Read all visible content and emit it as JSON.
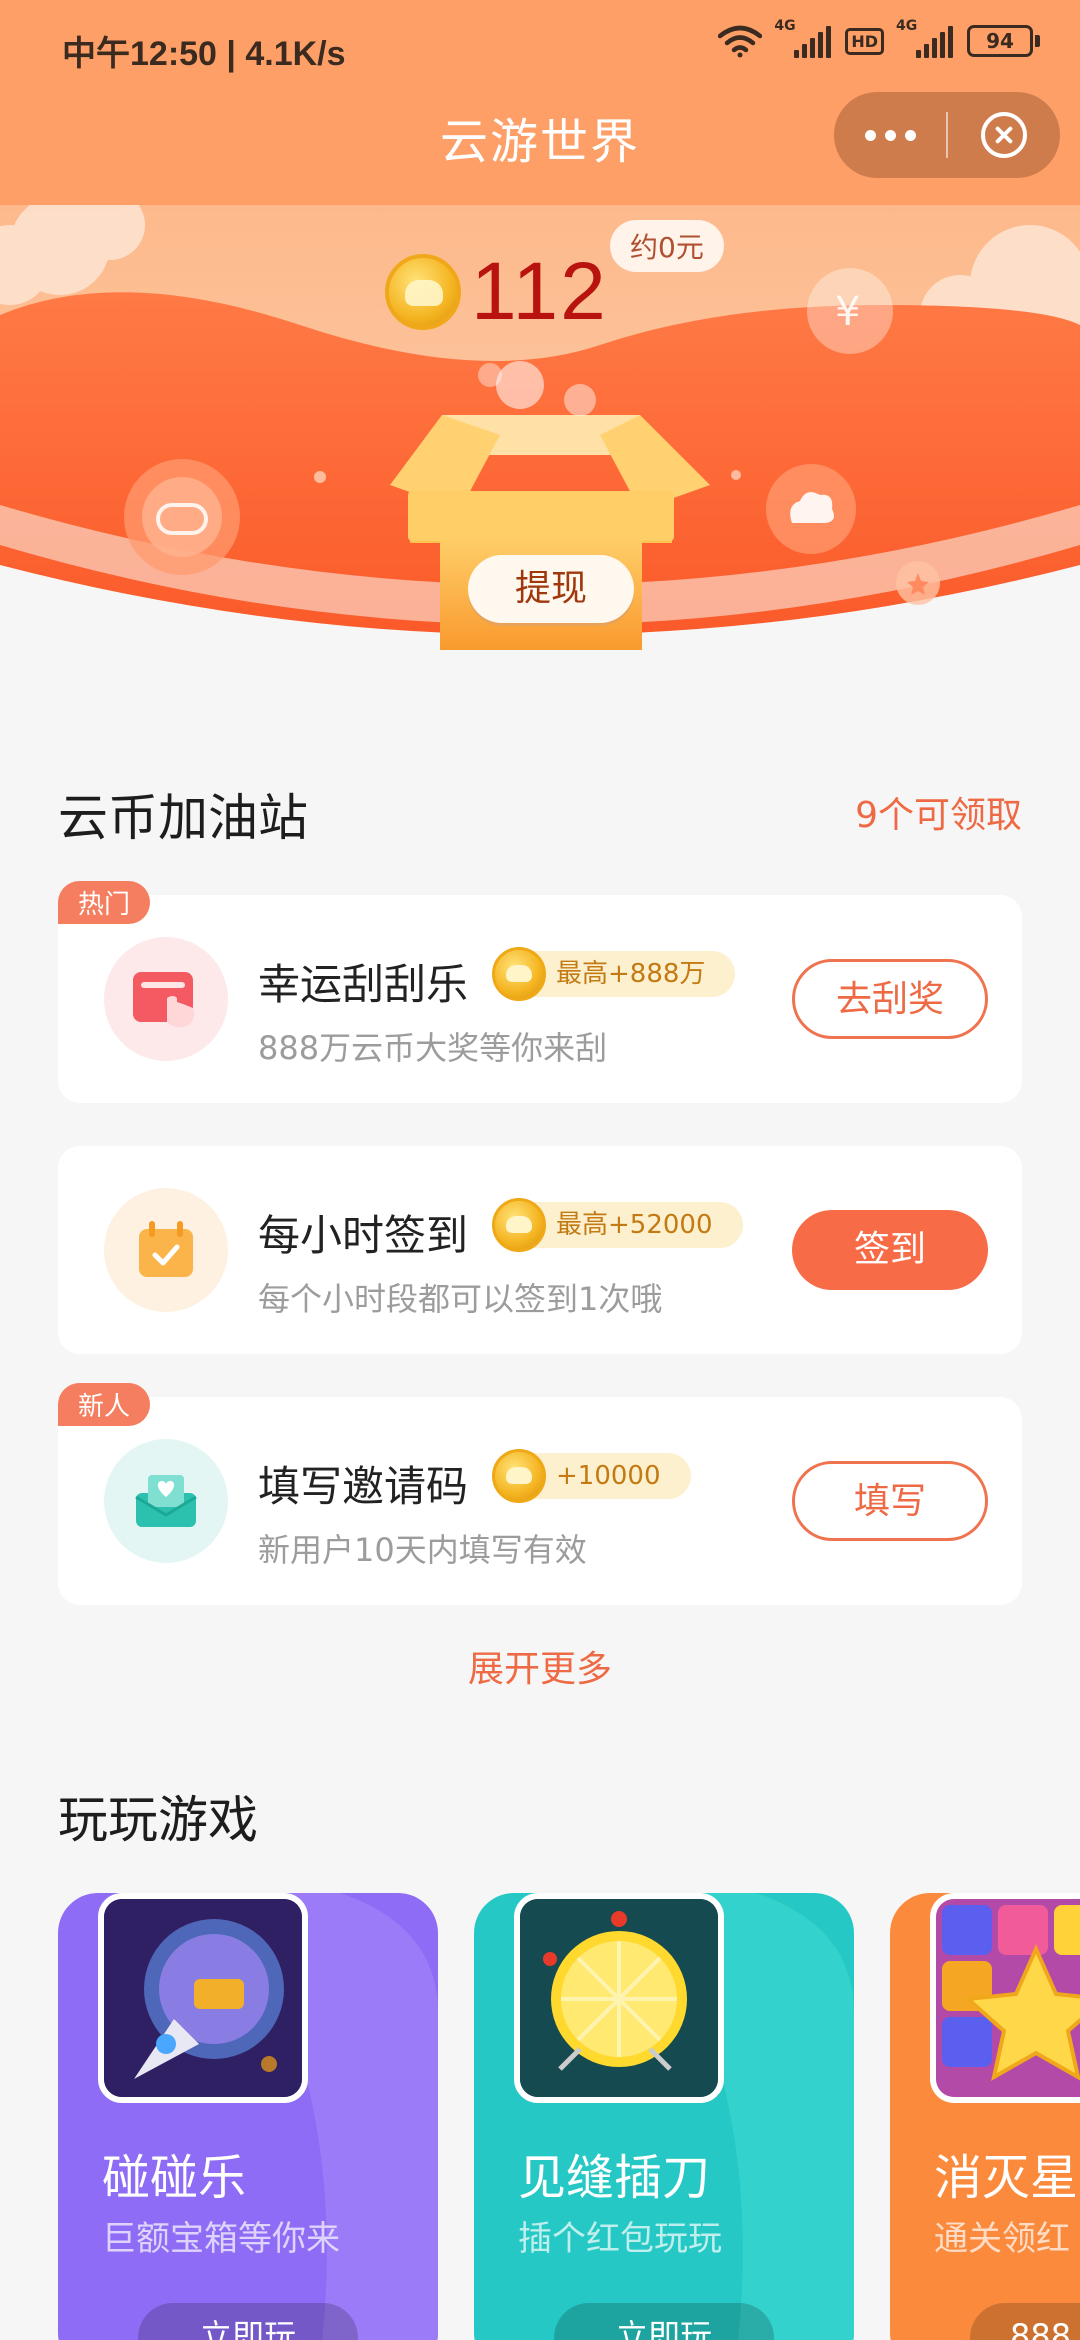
{
  "status_bar": {
    "time_speed": "中午12:50 | 4.1K/s",
    "network_1": "4G",
    "hd": "HD",
    "network_2": "4G",
    "battery": "94"
  },
  "nav": {
    "title": "云游世界"
  },
  "hero": {
    "coin_balance": "112",
    "cash_equivalent": "约0元",
    "withdraw_label": "提现"
  },
  "station": {
    "title": "云币加油站",
    "claimable": "9个可领取",
    "tasks": [
      {
        "tag": "热门",
        "icon": "scratch-card-icon",
        "title": "幸运刮刮乐",
        "reward": "最高+888万",
        "subtitle": "888万云币大奖等你来刮",
        "button": "去刮奖"
      },
      {
        "tag": "",
        "icon": "calendar-check-icon",
        "title": "每小时签到",
        "reward": "最高+52000",
        "subtitle": "每个小时段都可以签到1次哦",
        "button": "签到"
      },
      {
        "tag": "新人",
        "icon": "envelope-heart-icon",
        "title": "填写邀请码",
        "reward": "+10000",
        "subtitle": "新用户10天内填写有效",
        "button": "填写"
      }
    ],
    "expand": "展开更多"
  },
  "games": {
    "title": "玩玩游戏",
    "items": [
      {
        "name": "碰碰乐",
        "desc": "巨额宝箱等你来",
        "button": "立即玩",
        "color": "#8e6cf5"
      },
      {
        "name": "见缝插刀",
        "desc": "插个红包玩玩",
        "button": "立即玩",
        "color": "#25c8c4"
      },
      {
        "name": "消灭星",
        "desc": "通关领红",
        "button": "888",
        "color": "#fb8a3c"
      }
    ]
  },
  "colors": {
    "accent": "#ee6a45",
    "header": "#fd9f66",
    "coin_text": "#b8130f"
  }
}
